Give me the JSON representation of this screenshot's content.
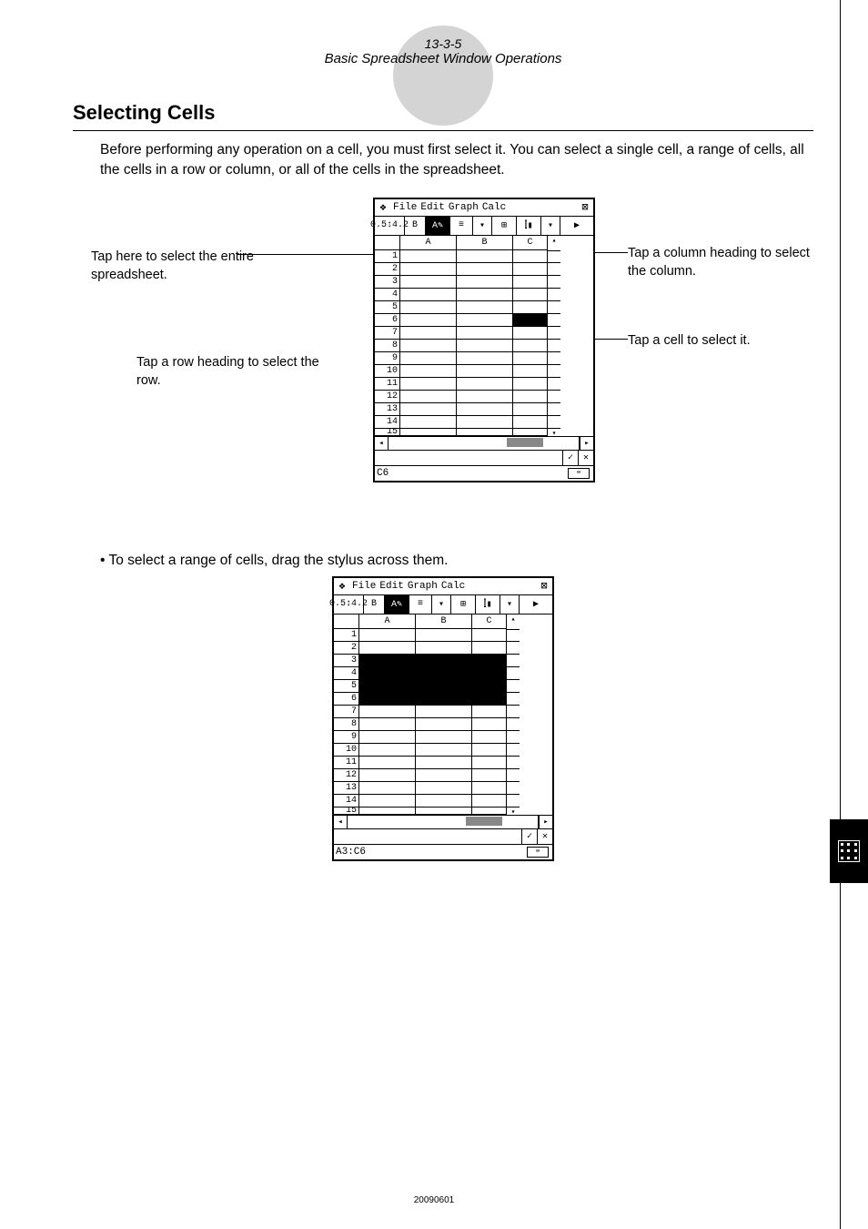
{
  "header": {
    "page_number": "13-3-5",
    "subtitle": "Basic Spreadsheet Window Operations"
  },
  "section": {
    "heading": "Selecting Cells",
    "intro": "Before performing any operation on a cell, you must first select it. You can select a single cell, a range of cells, all the cells in a row or column, or all of the cells in the spreadsheet.",
    "bullet": "• To select a range of cells, drag the stylus across them."
  },
  "callouts": {
    "left_top": "Tap here to select the entire spreadsheet.",
    "left_mid": "Tap a row heading to select the row.",
    "right_top": "Tap a column heading to select the column.",
    "right_mid": "Tap a cell to select it."
  },
  "calculator": {
    "menubar": [
      "File",
      "Edit",
      "Graph",
      "Calc"
    ],
    "toolbar": [
      "0.5↕4.2",
      "B",
      "A✎",
      "≡",
      "▾",
      "⊞",
      "⫿▮",
      "▾",
      "▶"
    ],
    "columns": [
      "A",
      "B",
      "C"
    ],
    "rows": [
      "1",
      "2",
      "3",
      "4",
      "5",
      "6",
      "7",
      "8",
      "9",
      "10",
      "11",
      "12",
      "13",
      "14",
      "15"
    ],
    "status_first": "C6",
    "status_second": "A3:C6",
    "ok_label": "✓",
    "x_label": "✕",
    "close_icon": "⊠"
  },
  "chart_data": null,
  "footer": "20090601"
}
